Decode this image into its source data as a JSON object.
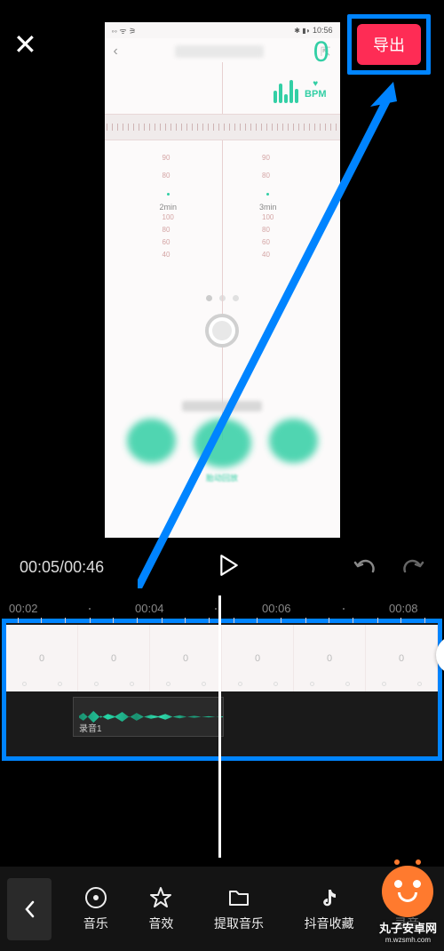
{
  "header": {
    "export_label": "导出"
  },
  "preview": {
    "status_time": "10:56",
    "bpm_label": "BPM",
    "chart_left_ticks": [
      "90",
      "80"
    ],
    "chart_right_ticks": [
      "90",
      "80"
    ],
    "chart_min_left": "2min",
    "chart_min_right": "3min",
    "meter_left_ticks": [
      "100",
      "80",
      "60",
      "40"
    ],
    "meter_right_ticks": [
      "100",
      "80",
      "60",
      "40"
    ],
    "big_number": "0",
    "bottom_caption": "胎动回放"
  },
  "playback": {
    "current_time": "00:05",
    "total_time": "00:46"
  },
  "ruler": {
    "t0": "00:02",
    "t1": "00:04",
    "t2": "00:06",
    "t3": "00:08"
  },
  "timeline": {
    "frame_value": "0",
    "audio_clip_label": "录音1",
    "add_label": "+"
  },
  "toolbar": {
    "items": [
      {
        "label": "音乐"
      },
      {
        "label": "音效"
      },
      {
        "label": "提取音乐"
      },
      {
        "label": "抖音收藏"
      },
      {
        "label": "录音"
      }
    ]
  },
  "watermark": {
    "brand": "丸子安卓网",
    "url": "m.wzsmh.com"
  }
}
